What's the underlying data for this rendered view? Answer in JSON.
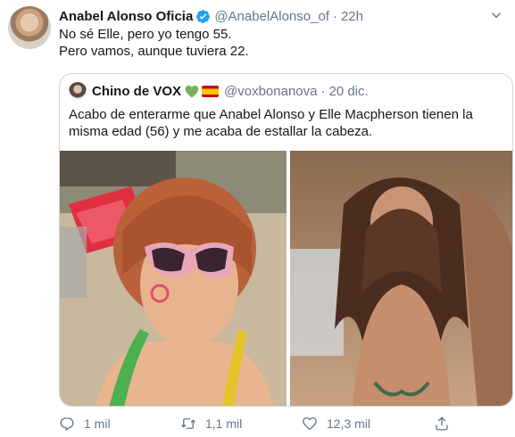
{
  "tweet": {
    "author_name": "Anabel Alonso Oficia",
    "handle": "@AnabelAlonso_of",
    "separator": "·",
    "time": "22h",
    "text_line1": "No sé Elle, pero yo tengo 55.",
    "text_line2": "Pero vamos, aunque tuviera 22."
  },
  "quoted": {
    "author_name": "Chino de VOX",
    "handle": "@voxbonanova",
    "separator": "·",
    "time": "20 dic.",
    "text": "Acabo de enterarme que Anabel Alonso y Elle Macpherson tienen la misma edad (56) y me acaba de estallar la cabeza."
  },
  "actions": {
    "reply_count": "1 mil",
    "retweet_count": "1,1 mil",
    "like_count": "12,3 mil"
  },
  "icons": {
    "verified": "verified-badge-icon",
    "caret": "chevron-down-icon",
    "reply": "reply-icon",
    "retweet": "retweet-icon",
    "like": "heart-icon",
    "share": "share-icon",
    "green_heart": "green-heart-emoji",
    "flag": "spain-flag-emoji"
  },
  "colors": {
    "accent": "#1da1f2",
    "secondary_text": "#657786",
    "border": "#ccd6dd",
    "green_heart": "#78b159"
  }
}
